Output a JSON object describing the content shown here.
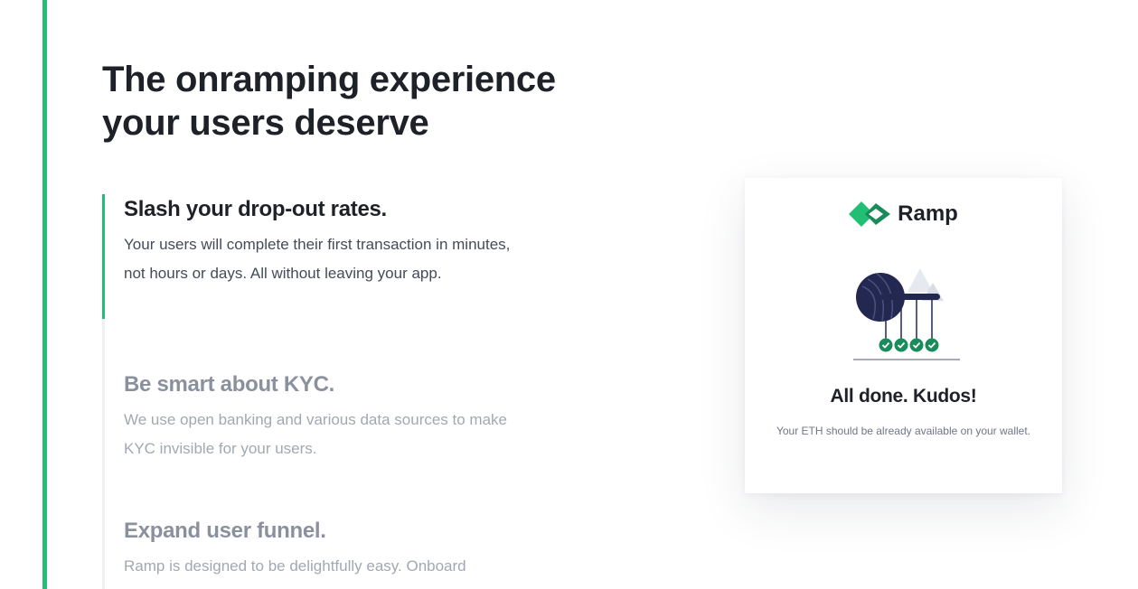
{
  "hero": {
    "title_line1": "The onramping experience",
    "title_line2": "your users deserve"
  },
  "features": [
    {
      "title": "Slash your drop-out rates.",
      "description": "Your users will complete their first transaction in minutes, not hours or days. All without leaving your app.",
      "active": true
    },
    {
      "title": "Be smart about KYC.",
      "description": "We use open banking and various data sources to make KYC invisible for your users.",
      "active": false
    },
    {
      "title": "Expand user funnel.",
      "description": "Ramp is designed to be delightfully easy. Onboard",
      "active": false
    }
  ],
  "card": {
    "brand_name": "Ramp",
    "logo_icon": "ramp-logo-icon",
    "illustration_icon": "success-illustration",
    "title": "All done. Kudos!",
    "subtitle": "Your ETH should be already available on your wallet."
  },
  "colors": {
    "accent": "#21bf73",
    "accent_dark": "#1a8c5b",
    "heading": "#1e2128",
    "muted": "#8a919d",
    "navy": "#232850"
  }
}
